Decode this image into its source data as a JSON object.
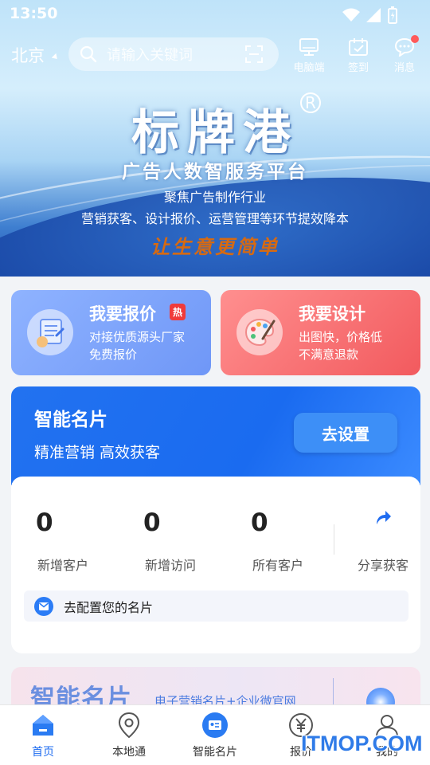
{
  "status_bar": {
    "time": "13:50"
  },
  "header": {
    "city": "北京",
    "search_placeholder": "请输入关键词",
    "actions": [
      {
        "label": "电脑端",
        "icon": "monitor-icon"
      },
      {
        "label": "签到",
        "icon": "calendar-check-icon"
      },
      {
        "label": "消息",
        "icon": "chat-bubble-icon",
        "badge": true
      }
    ]
  },
  "hero": {
    "title": "标牌港",
    "registered_mark": "R",
    "subtitle": "广告人数智服务平台",
    "desc_line1": "聚焦广告制作行业",
    "desc_line2": "营销获客、设计报价、运营管理等环节提效降本",
    "slogan": "让生意更简单"
  },
  "quick_cards": [
    {
      "title": "我要报价",
      "badge": "热",
      "desc_line1": "对接优质源头厂家",
      "desc_line2": "免费报价",
      "icon": "quote-scroll-icon",
      "color": "#7ea4fb"
    },
    {
      "title": "我要设计",
      "desc_line1": "出图快，价格低",
      "desc_line2": "不满意退款",
      "icon": "palette-icon",
      "color": "#f56d70"
    }
  ],
  "smart_card": {
    "title": "智能名片",
    "subtitle": "精准营销 高效获客",
    "button": "去设置",
    "stats": [
      {
        "value": "0",
        "label": "新增客户"
      },
      {
        "value": "0",
        "label": "新增访问"
      },
      {
        "value": "0",
        "label": "所有客户"
      }
    ],
    "share_label": "分享获客",
    "config_text": "去配置您的名片"
  },
  "banner": {
    "title": "智能名片",
    "subtitle": "电子营销名片+企业微官网"
  },
  "tabs": [
    {
      "label": "首页",
      "icon": "home-icon",
      "active": true
    },
    {
      "label": "本地通",
      "icon": "location-pin-icon",
      "active": false
    },
    {
      "label": "智能名片",
      "icon": "business-card-icon",
      "active": false
    },
    {
      "label": "报价",
      "icon": "yuan-icon",
      "active": false
    },
    {
      "label": "我的",
      "icon": "user-icon",
      "active": false
    }
  ],
  "watermark": "ITMOP.COM",
  "colors": {
    "accent": "#1f6cf0",
    "hot": "#f03b3b",
    "slogan": "#d66a12"
  }
}
